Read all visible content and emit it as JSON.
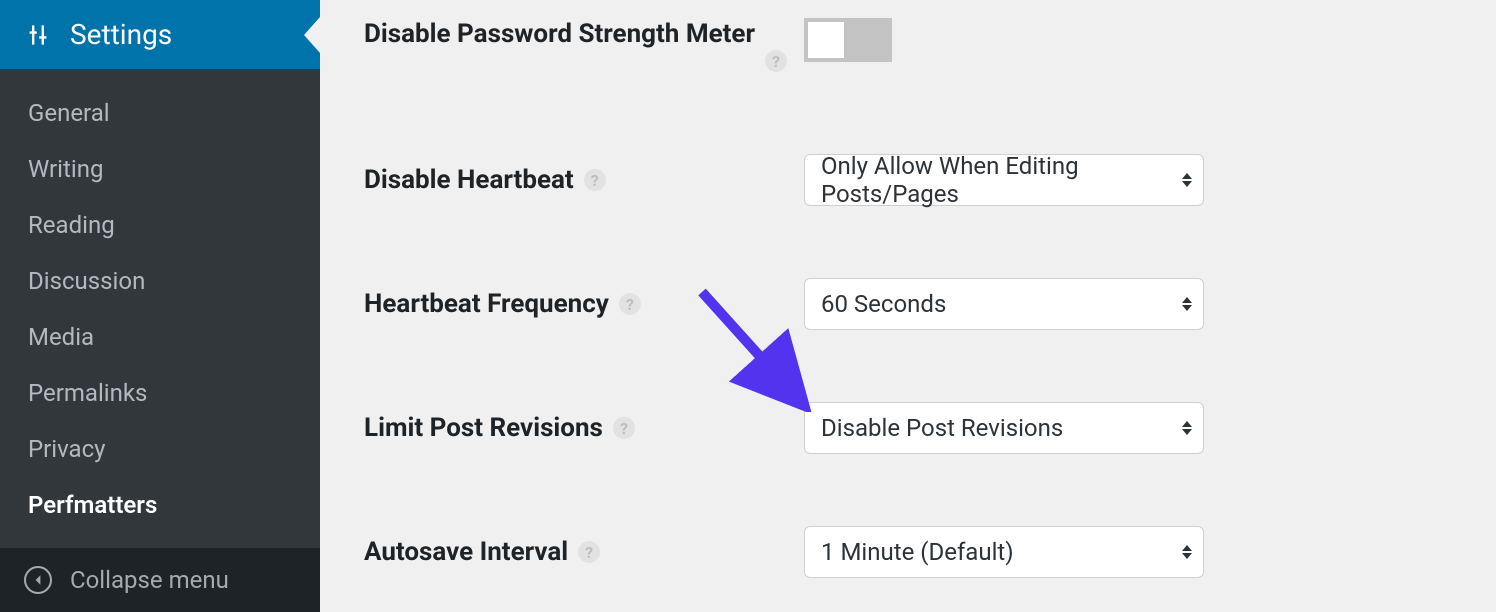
{
  "sidebar": {
    "header_label": "Settings",
    "items": [
      {
        "label": "General",
        "active": false
      },
      {
        "label": "Writing",
        "active": false
      },
      {
        "label": "Reading",
        "active": false
      },
      {
        "label": "Discussion",
        "active": false
      },
      {
        "label": "Media",
        "active": false
      },
      {
        "label": "Permalinks",
        "active": false
      },
      {
        "label": "Privacy",
        "active": false
      },
      {
        "label": "Perfmatters",
        "active": true
      }
    ],
    "collapse_label": "Collapse menu"
  },
  "settings": {
    "password_meter_label": "Disable Password Strength Meter",
    "heartbeat_label": "Disable Heartbeat",
    "heartbeat_value": "Only Allow When Editing Posts/Pages",
    "frequency_label": "Heartbeat Frequency",
    "frequency_value": "60 Seconds",
    "revisions_label": "Limit Post Revisions",
    "revisions_value": "Disable Post Revisions",
    "autosave_label": "Autosave Interval",
    "autosave_value": "1 Minute (Default)",
    "help_glyph": "?"
  },
  "colors": {
    "accent": "#0073aa",
    "arrow": "#5333ed"
  }
}
